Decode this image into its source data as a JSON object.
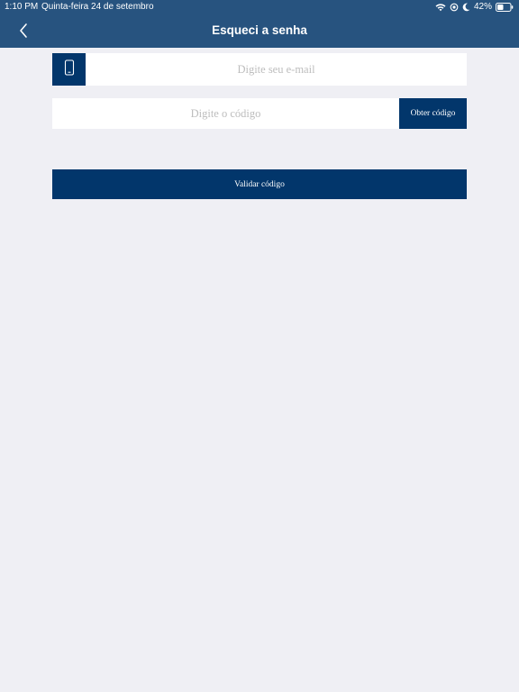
{
  "status_bar": {
    "time": "1:10 PM",
    "date": "Quinta-feira 24 de setembro",
    "battery_percent": "42%",
    "icons": [
      "wifi-icon",
      "location-lock-icon",
      "moon-icon",
      "battery-icon"
    ]
  },
  "nav": {
    "title": "Esqueci a senha",
    "back_icon": "chevron-left-icon"
  },
  "form": {
    "email_icon": "phone-icon",
    "email_value": "",
    "email_placeholder": "Digite seu e-mail",
    "code_value": "",
    "code_placeholder": "Digite o código",
    "get_code_label": "Obter código",
    "validate_label": "Validar código"
  },
  "colors": {
    "header_bg": "#27537f",
    "primary": "#02366b",
    "page_bg": "#efeff4",
    "placeholder": "#bdbdbd"
  }
}
